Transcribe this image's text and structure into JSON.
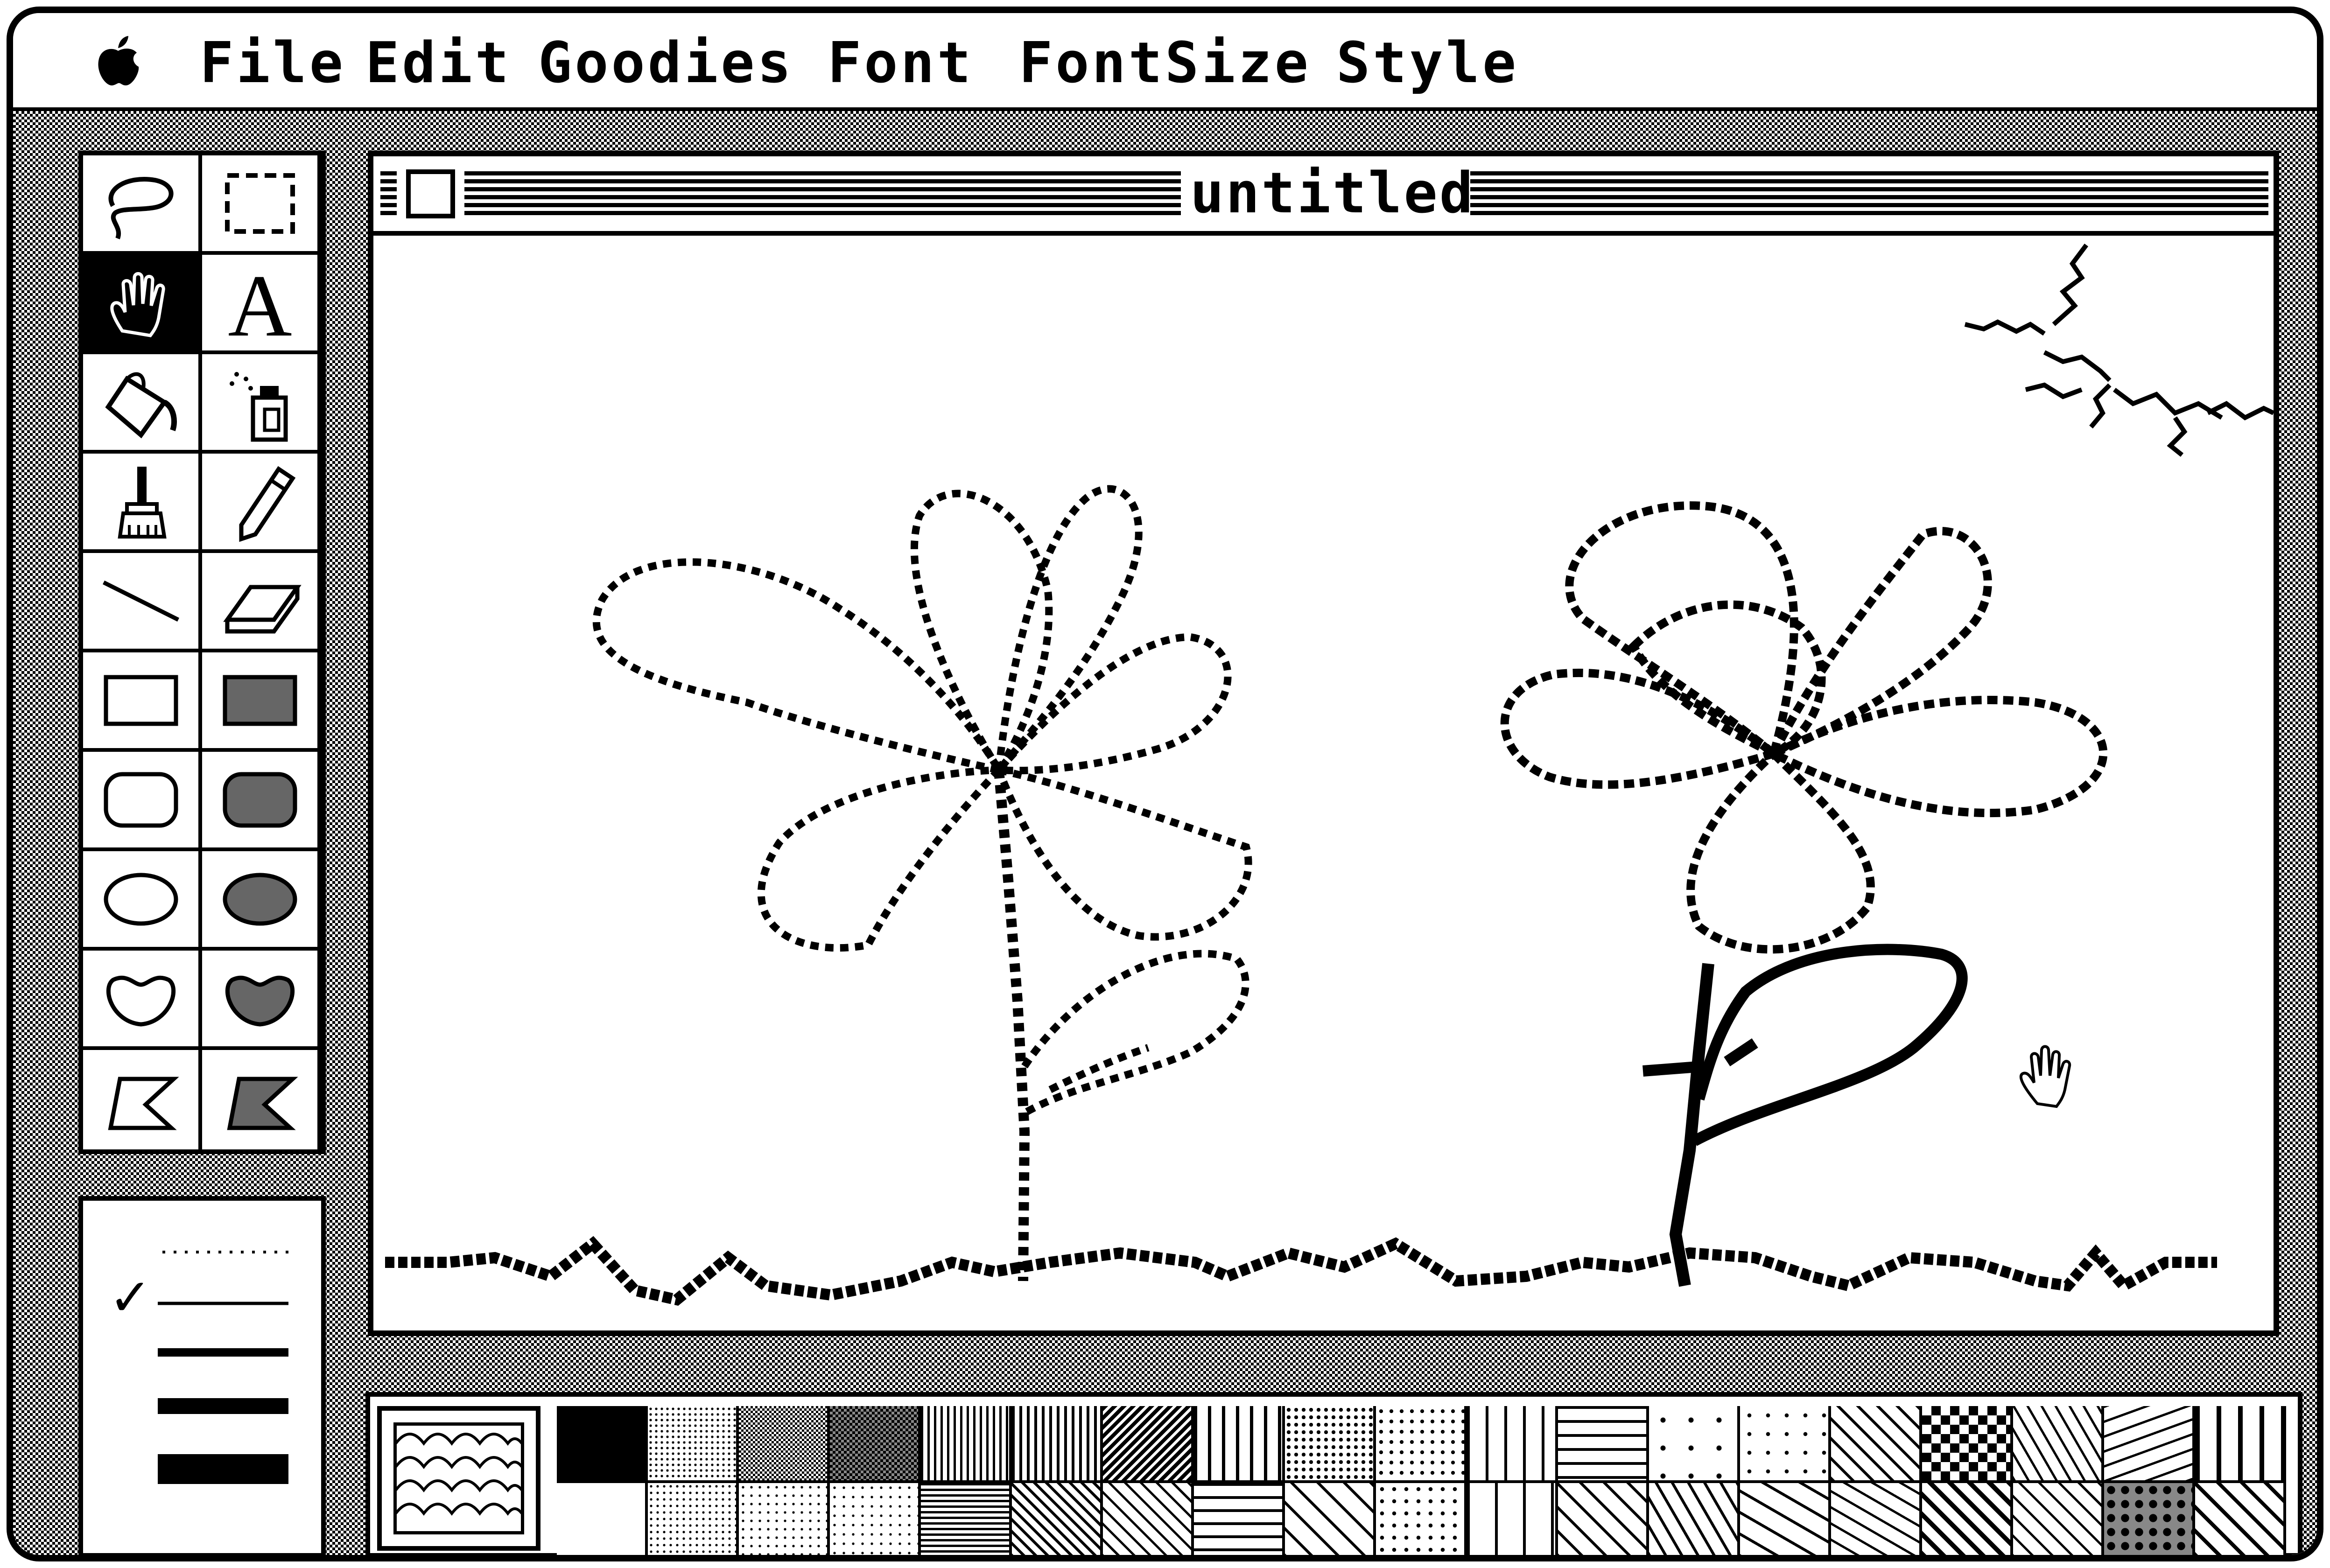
{
  "menubar": {
    "apple": "",
    "items": [
      "File",
      "Edit",
      "Goodies",
      "Font",
      "FontSize",
      "Style"
    ]
  },
  "toolbox": {
    "tools": [
      {
        "name": "lasso",
        "selected": false
      },
      {
        "name": "selection-rectangle",
        "selected": false
      },
      {
        "name": "grabber-hand",
        "selected": true
      },
      {
        "name": "text",
        "label": "A",
        "selected": false
      },
      {
        "name": "paint-bucket",
        "selected": false
      },
      {
        "name": "spray-can",
        "selected": false
      },
      {
        "name": "paintbrush",
        "selected": false
      },
      {
        "name": "pencil",
        "selected": false
      },
      {
        "name": "line",
        "selected": false
      },
      {
        "name": "eraser",
        "selected": false
      },
      {
        "name": "rectangle",
        "selected": false
      },
      {
        "name": "filled-rectangle",
        "selected": false
      },
      {
        "name": "rounded-rectangle",
        "selected": false
      },
      {
        "name": "filled-rounded-rectangle",
        "selected": false
      },
      {
        "name": "oval",
        "selected": false
      },
      {
        "name": "filled-oval",
        "selected": false
      },
      {
        "name": "freeform",
        "selected": false
      },
      {
        "name": "filled-freeform",
        "selected": false
      },
      {
        "name": "polygon",
        "selected": false
      },
      {
        "name": "filled-polygon",
        "selected": false
      }
    ]
  },
  "line_widths": {
    "options": [
      "dotted",
      "1",
      "2",
      "3",
      "4"
    ],
    "selected": "1",
    "check_mark": "✓"
  },
  "window": {
    "title": "untitled"
  },
  "canvas": {
    "drawing": [
      "left-flower",
      "right-flower",
      "sun-rays",
      "grass",
      "hand-cursor"
    ]
  },
  "patterns": {
    "selected": "scales",
    "count": 38
  },
  "colors": {
    "ink": "#000000",
    "paper": "#ffffff"
  }
}
